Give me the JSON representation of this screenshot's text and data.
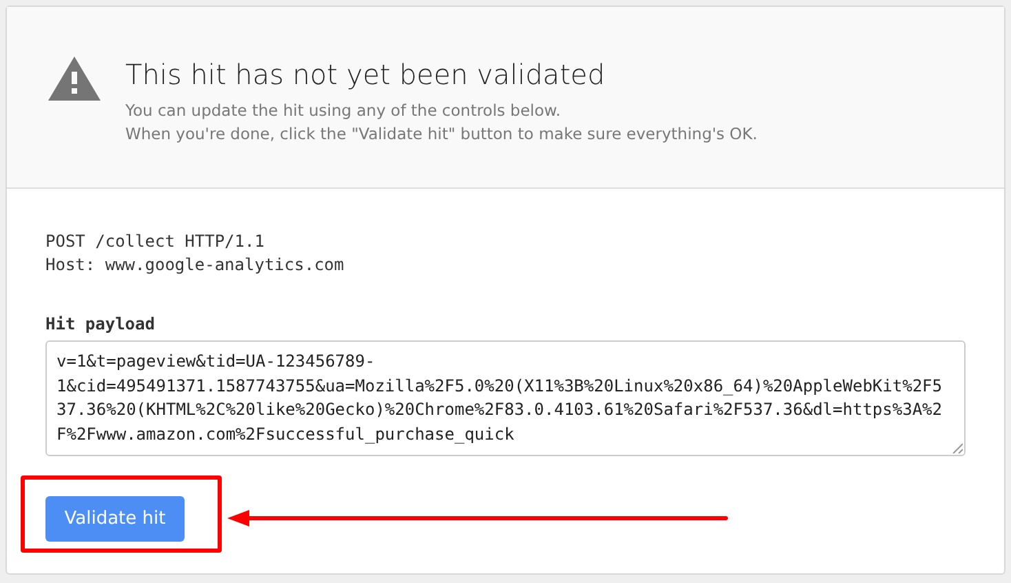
{
  "header": {
    "title": "This hit has not yet been validated",
    "lines": [
      "You can update the hit using any of the controls below.",
      "When you're done, click the \"Validate hit\" button to make sure everything's OK."
    ]
  },
  "request": {
    "lines": [
      "POST /collect HTTP/1.1",
      "Host: www.google-analytics.com"
    ]
  },
  "payload": {
    "label": "Hit payload",
    "value": "v=1&t=pageview&tid=UA-123456789-1&cid=495491371.1587743755&ua=Mozilla%2F5.0%20(X11%3B%20Linux%20x86_64)%20AppleWebKit%2F537.36%20(KHTML%2C%20like%20Gecko)%20Chrome%2F83.0.4103.61%20Safari%2F537.36&dl=https%3A%2F%2Fwww.amazon.com%2Fsuccessful_purchase_quick"
  },
  "button": {
    "label": "Validate hit"
  }
}
